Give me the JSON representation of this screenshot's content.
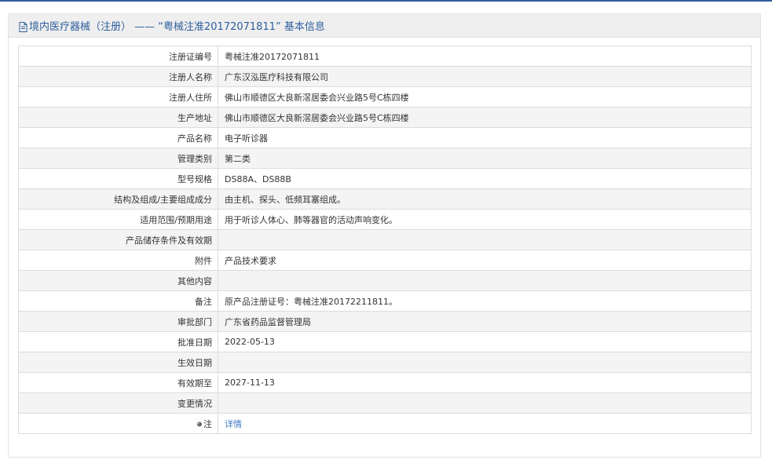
{
  "header": {
    "title": "境内医疗器械（注册） —— “粤械注准20172071811” 基本信息",
    "icon": "document-icon",
    "accent_color": "#2e5e9e"
  },
  "rows": [
    {
      "label": "注册证编号",
      "value": "粤械注准20172071811"
    },
    {
      "label": "注册人名称",
      "value": "广东汉泓医疗科技有限公司"
    },
    {
      "label": "注册人住所",
      "value": "佛山市顺德区大良新滘居委会兴业路5号C栋四楼"
    },
    {
      "label": "生产地址",
      "value": "佛山市顺德区大良新滘居委会兴业路5号C栋四楼"
    },
    {
      "label": "产品名称",
      "value": "电子听诊器"
    },
    {
      "label": "管理类别",
      "value": "第二类"
    },
    {
      "label": "型号规格",
      "value": "DS88A、DS88B"
    },
    {
      "label": "结构及组成/主要组成成分",
      "value": "由主机、探头、低频耳塞组成。"
    },
    {
      "label": "适用范围/预期用途",
      "value": "用于听诊人体心、肺等器官的活动声响变化。"
    },
    {
      "label": "产品储存条件及有效期",
      "value": ""
    },
    {
      "label": "附件",
      "value": "产品技术要求"
    },
    {
      "label": "其他内容",
      "value": ""
    },
    {
      "label": "备注",
      "value": "原产品注册证号：粤械注准20172211811。"
    },
    {
      "label": "审批部门",
      "value": "广东省药品监督管理局"
    },
    {
      "label": "批准日期",
      "value": "2022-05-13"
    },
    {
      "label": "生效日期",
      "value": ""
    },
    {
      "label": "有效期至",
      "value": "2027-11-13"
    },
    {
      "label": "变更情况",
      "value": ""
    }
  ],
  "note_row": {
    "label": "注",
    "icon": "pin-icon",
    "link_text": "详情",
    "link_color": "#3c79c4"
  }
}
